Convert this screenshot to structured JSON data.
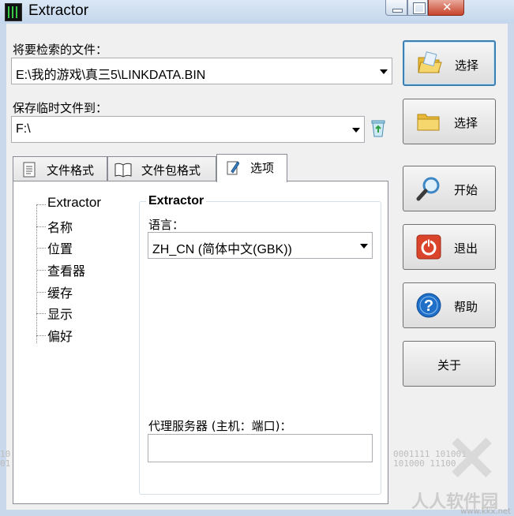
{
  "window": {
    "title": "Extractor"
  },
  "search_file": {
    "label": "将要检索的文件：",
    "value": "E:\\我的游戏\\真三5\\LINKDATA.BIN"
  },
  "save_to": {
    "label": "保存临时文件到：",
    "value": "F:\\"
  },
  "buttons": {
    "select1": "选择",
    "select2": "选择",
    "start": "开始",
    "exit": "退出",
    "help": "帮助",
    "about": "关于"
  },
  "tabs": [
    {
      "label": "文件格式"
    },
    {
      "label": "文件包格式"
    },
    {
      "label": "选项"
    }
  ],
  "tree": {
    "items": [
      "Extractor",
      "名称",
      "位置",
      "查看器",
      "缓存",
      "显示",
      "偏好"
    ],
    "selected": "Extractor"
  },
  "options": {
    "group_title": "Extractor",
    "language_label": "语言：",
    "language_value": "ZH_CN (简体中文(GBK))",
    "proxy_label": "代理服务器 (主机：端口)：",
    "proxy_value": ""
  },
  "watermark": {
    "site_cn": "人人软件园",
    "url": "www.kkx.net",
    "binary_left": "10\n01",
    "binary_right": "0001111 101001\n101000 11100"
  },
  "colors": {
    "accent": "#3c7fb1",
    "exit_red": "#d9442a",
    "help_blue": "#1f6fc8",
    "folder_yellow": "#f2cc5a"
  }
}
